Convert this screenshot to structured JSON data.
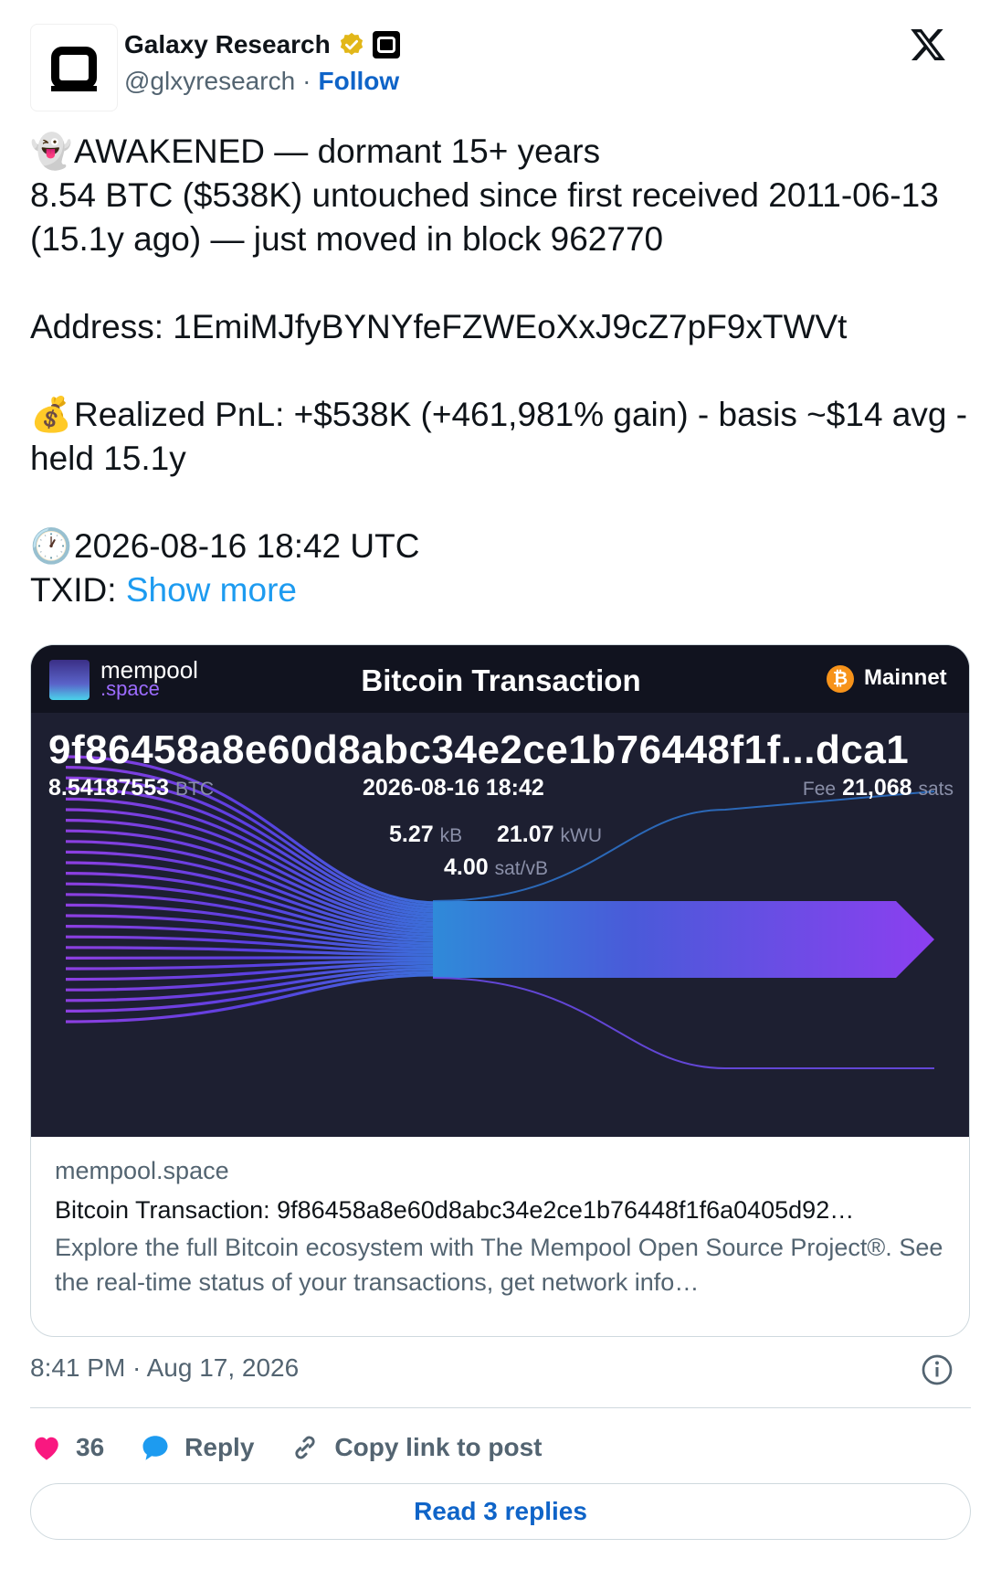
{
  "author": {
    "display_name": "Galaxy Research",
    "handle": "@glxyresearch",
    "separator": "·",
    "follow_label": "Follow"
  },
  "tweet": {
    "line1_emoji": "👻",
    "line1": "AWAKENED — dormant 15+ years",
    "line2": "8.54 BTC ($538K) untouched since first received 2011-06-13 (15.1y ago) — just moved in block 962770",
    "address_line": "Address: 1EmiMJfyBYNYfeFZWEoXxJ9cZ7pF9xTWVt",
    "pnl_emoji": "💰",
    "pnl_line": "Realized PnL: +$538K (+461,981% gain) - basis ~$14 avg - held 15.1y",
    "time_emoji": "🕐",
    "time_line": "2026-08-16 18:42 UTC",
    "txid_label": "TXID:",
    "show_more": "Show more"
  },
  "media": {
    "brand_top": "mempool",
    "brand_bottom": ".space",
    "title": "Bitcoin Transaction",
    "network": "Mainnet",
    "btc_symbol": "₿",
    "txid": "9f86458a8e60d8abc34e2ce1b76448f1f...dca1",
    "amount": "8.54187553",
    "amount_unit": "BTC",
    "datetime": "2026-08-16 18:42",
    "fee_label": "Fee",
    "fee_value": "21,068",
    "fee_unit": "sats",
    "size_value": "5.27",
    "size_unit": "kB",
    "weight_value": "21.07",
    "weight_unit": "kWU",
    "feerate_value": "4.00",
    "feerate_unit": "sat/vB"
  },
  "link_card": {
    "domain": "mempool.space",
    "title": "Bitcoin Transaction: 9f86458a8e60d8abc34e2ce1b76448f1f6a0405d92…",
    "description": "Explore the full Bitcoin ecosystem with The Mempool Open Source Project®. See the real-time status of your transactions, get network info…"
  },
  "footer": {
    "timestamp": "8:41 PM · Aug 17, 2026",
    "like_count": "36",
    "reply_label": "Reply",
    "copy_link_label": "Copy link to post",
    "read_replies_label": "Read 3 replies"
  },
  "colors": {
    "follow": "#0f64c8",
    "link": "#1d9bf0",
    "like": "#f91880",
    "reply": "#1d9bf0",
    "verified": "#e2b719",
    "media_bg": "#1d1f31"
  },
  "icons": [
    "x-logo-icon",
    "verified-badge-icon",
    "affiliate-badge-icon",
    "ghost-emoji-icon",
    "money-bag-emoji-icon",
    "clock-emoji-icon",
    "bitcoin-icon",
    "info-icon",
    "heart-icon",
    "reply-bubble-icon",
    "link-icon"
  ]
}
